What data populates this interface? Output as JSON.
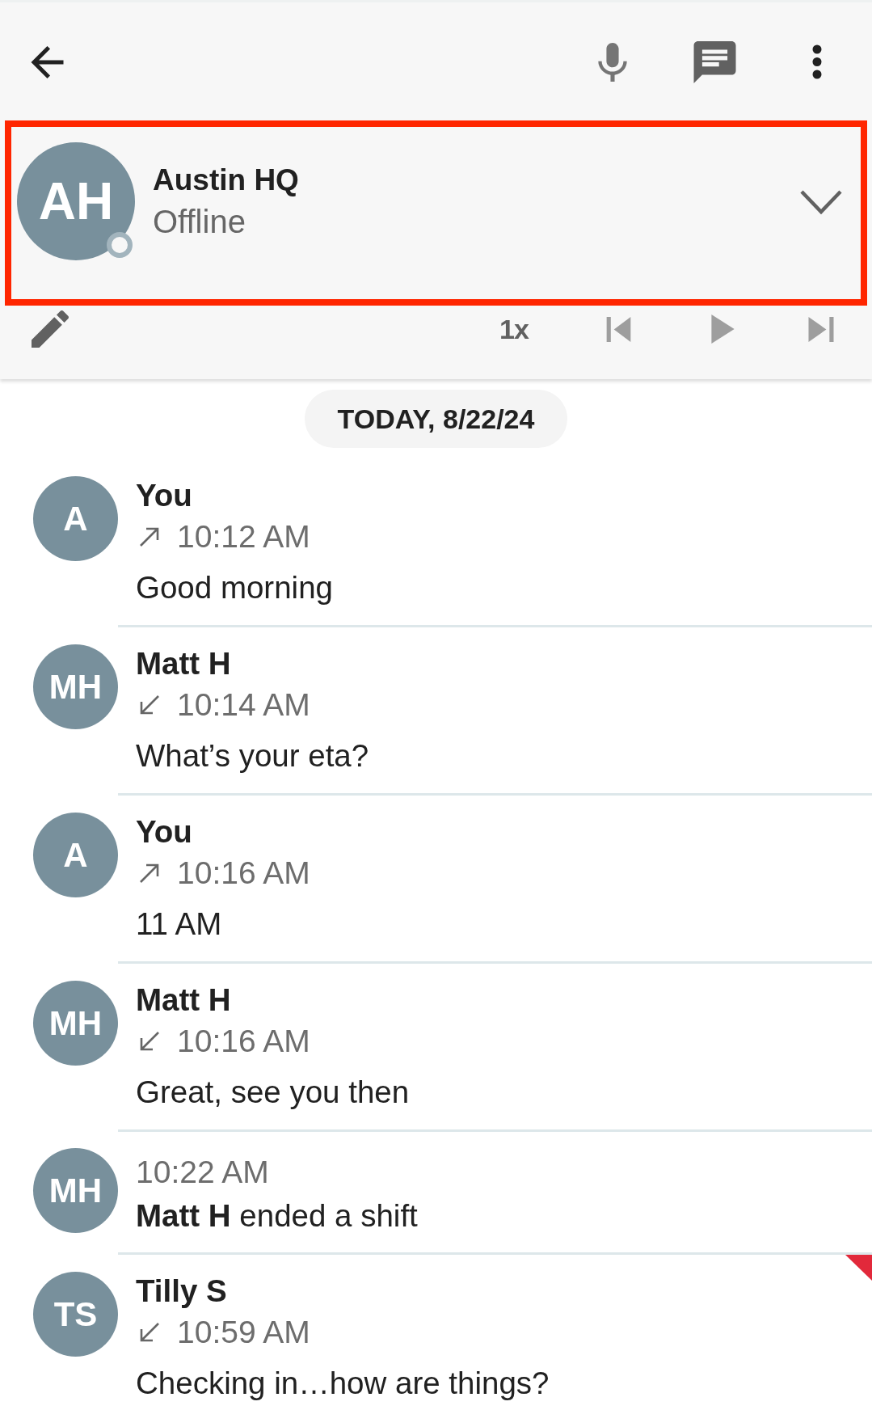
{
  "contact": {
    "initials": "AH",
    "name": "Austin HQ",
    "status": "Offline",
    "online": false,
    "highlighted": true
  },
  "playback": {
    "speed": "1x"
  },
  "date_separator": "TODAY, 8/22/24",
  "messages": [
    {
      "kind": "message",
      "initials": "A",
      "sender": "You",
      "outgoing": true,
      "time": "10:12 AM",
      "text": "Good morning",
      "flagged": false
    },
    {
      "kind": "message",
      "initials": "MH",
      "sender": "Matt H",
      "outgoing": false,
      "time": "10:14 AM",
      "text": "What’s your eta?",
      "flagged": false
    },
    {
      "kind": "message",
      "initials": "A",
      "sender": "You",
      "outgoing": true,
      "time": "10:16 AM",
      "text": "11 AM",
      "flagged": false
    },
    {
      "kind": "message",
      "initials": "MH",
      "sender": "Matt H",
      "outgoing": false,
      "time": "10:16 AM",
      "text": "Great, see you then",
      "flagged": false
    },
    {
      "kind": "event",
      "initials": "MH",
      "time": "10:22 AM",
      "text": "**Matt H** ended a shift",
      "flagged": false
    },
    {
      "kind": "message",
      "initials": "TS",
      "sender": "Tilly S",
      "outgoing": false,
      "time": "10:59 AM",
      "text": "Checking in…how are things?",
      "flagged": true
    }
  ]
}
